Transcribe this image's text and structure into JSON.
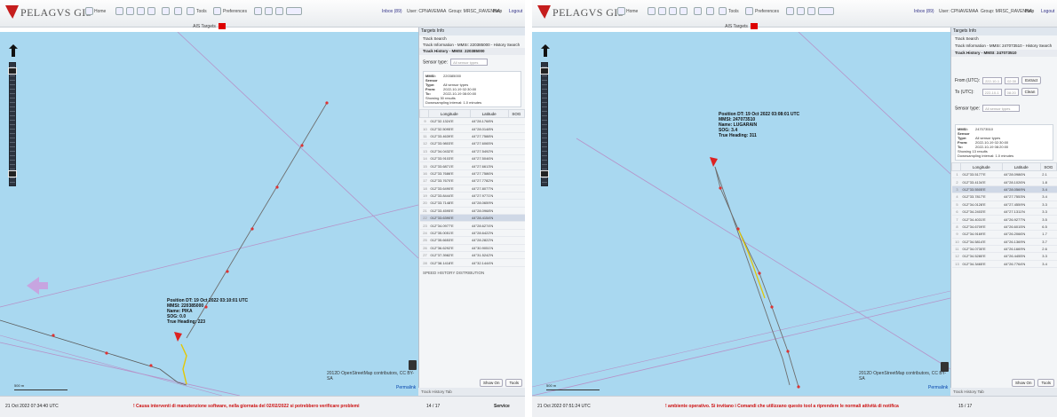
{
  "app": {
    "brand": "PELAGVS GIS",
    "home": "Home",
    "tools": "Tools",
    "preferences": "Preferences",
    "inbox_left": "Inbox (89)",
    "inbox_right": "Inbox (89)",
    "user_left": "User: CPNAVEMAA",
    "user_right": "User: CPNAVEMAA",
    "group_left": "Group: MRSC_RAVENNA",
    "group_right": "Group: MRSC_RAVENNA",
    "help": "Help",
    "logout": "Logout",
    "ais_targets": "AIS Targets"
  },
  "left": {
    "position_info": [
      "Position DT: 19 Oct 2022 03:10:01 UTC",
      "MMSI: 220385000",
      "Name: PIKA",
      "SOG: 0.0",
      "True Heading: 223"
    ],
    "attribution": "2012D OpenStreetMap contributors, CC BY-SA",
    "permalink": "Permalink",
    "scale_top": "500 m",
    "scale_bottom": "1 km",
    "sidebar": {
      "title": "Targets Info",
      "items": [
        "Track Search",
        "Track Information - MMSI: 220385000 - History Search",
        "Track History - MMSI: 220385000"
      ],
      "sensor_type_label": "Sensor type:",
      "sensor_type_placeholder": "All sensor types",
      "info": {
        "mmsi": "220385000",
        "sensor_type": "All sensor types",
        "from": "2022-10-19 02:30:00",
        "to": "2022-10-19 08:00:00",
        "showing": "Showing 30 results",
        "interval": "Downsampling interval: 1.0 minutes"
      },
      "columns": [
        "Longitude",
        "Latitude",
        "SOG"
      ],
      "rows": [
        [
          "9",
          "012°32.1324'E",
          "44°28.1768'N"
        ],
        [
          "10",
          "012°32.5095'E",
          "44°28.0148'N"
        ],
        [
          "11",
          "012°33.4639'E",
          "44°27.7588'N"
        ],
        [
          "12",
          "012°33.9803'E",
          "44°27.6065'N"
        ],
        [
          "13",
          "012°34.0432'E",
          "44°27.5492'N"
        ],
        [
          "14",
          "012°33.9103'E",
          "44°27.5046'N"
        ],
        [
          "15",
          "012°33.6871'E",
          "44°27.6613'N"
        ],
        [
          "16",
          "012°33.7686'E",
          "44°27.7586'N"
        ],
        [
          "17",
          "012°33.7670'E",
          "44°27.7782'N"
        ],
        [
          "18",
          "012°33.6490'E",
          "44°27.8077'N"
        ],
        [
          "19",
          "012°33.8444'E",
          "44°27.9771'N"
        ],
        [
          "20",
          "012°33.7148'E",
          "44°28.0659'N"
        ],
        [
          "21",
          "012°33.4595'E",
          "44°28.0968'N"
        ],
        [
          "22",
          "012°33.6390'E",
          "44°28.4154'N"
        ],
        [
          "23",
          "012°34.0977'E",
          "44°28.6274'N"
        ],
        [
          "24",
          "012°35.0051'E",
          "44°28.6422'N"
        ],
        [
          "25",
          "012°35.6653'E",
          "44°28.2822'N"
        ],
        [
          "26",
          "012°36.6292'E",
          "44°30.9051'N"
        ],
        [
          "27",
          "012°37.3982'E",
          "44°31.5242'N"
        ],
        [
          "28",
          "012°38.1418'E",
          "44°32.1444'N"
        ]
      ],
      "speed_history": "SPEED HISTORY DISTRIBUTION",
      "show_on": "Show On",
      "tools": "Tools",
      "track_history_tab": "Track History Tab"
    },
    "status": {
      "time": "21 Oct 2022 07:34:40 UTC",
      "warning": "! Causa interventi di manutenzione software, nella giornata del 02/02/2022 si potrebbero verificare problemi",
      "page": "14 / 17",
      "service": "Service"
    }
  },
  "right": {
    "position_info": [
      "Position DT: 19 Oct 2022 03:08:01 UTC",
      "MMSI: 247073510",
      "Name: LUGARAIN",
      "SOG: 3.4",
      "True Heading: 311"
    ],
    "attribution": "2012D OpenStreetMap contributors, CC BY-SA",
    "permalink": "Permalink",
    "scale_top": "500 m",
    "scale_bottom": "1 km",
    "sidebar": {
      "title": "Targets Info",
      "items": [
        "Track Search",
        "Track Information - MMSI: 247073510 - History Search",
        "Track History - MMSI: 247073510"
      ],
      "from_label": "From (UTC):",
      "from_date": "222-10-1",
      "from_time": "02:30",
      "to_label": "To (UTC):",
      "to_date": "222-10-1",
      "to_time": "08:20",
      "extract": "Extract",
      "clean": "Clean",
      "sensor_type_label": "Sensor type:",
      "sensor_type_placeholder": "All sensor types",
      "info": {
        "mmsi": "247073510",
        "sensor_type": "All sensor types",
        "from": "2022-10-19 02:30:00",
        "to": "2022-10-19 08:20:00",
        "showing": "Showing 13 results",
        "interval": "Downsampling interval: 1.0 minutes"
      },
      "columns": [
        "Longitude",
        "Latitude",
        "SOG"
      ],
      "rows": [
        [
          "1",
          "012°33.5177'E",
          "44°28.0986'N",
          "2.1"
        ],
        [
          "2",
          "012°33.4134'E",
          "44°28.1026'N",
          "1.8"
        ],
        [
          "3",
          "012°33.5505'E",
          "44°28.0569'N",
          "3.4"
        ],
        [
          "4",
          "012°33.7817'E",
          "44°27.7553'N",
          "3.4"
        ],
        [
          "5",
          "012°34.0128'E",
          "44°27.4559'N",
          "3.3"
        ],
        [
          "6",
          "012°34.2403'E",
          "44°27.1311'N",
          "3.3"
        ],
        [
          "7",
          "012°34.4031'E",
          "44°26.9277'N",
          "3.5"
        ],
        [
          "8",
          "012°34.6709'E",
          "44°26.6015'N",
          "6.5"
        ],
        [
          "9",
          "012°34.9169'E",
          "44°26.2066'N",
          "1.7"
        ],
        [
          "10",
          "012°34.5814'E",
          "44°26.1369'N",
          "3.7"
        ],
        [
          "11",
          "012°34.0730'E",
          "44°26.1669'N",
          "2.6"
        ],
        [
          "12",
          "012°34.5280'E",
          "44°26.4455'N",
          "3.3"
        ],
        [
          "13",
          "012°34.3465'E",
          "44°26.7764'N",
          "3.4"
        ]
      ],
      "show_on": "Show On",
      "tools": "Tools",
      "track_history_tab": "Track History Tab"
    },
    "status": {
      "time": "21 Oct 2022 07:51:24 UTC",
      "warning": "! ambiente operativo. Si invitano i Comandi che utilizzano questo tool a riprendere le normali attività di notifica",
      "page": "15 / 17"
    }
  }
}
